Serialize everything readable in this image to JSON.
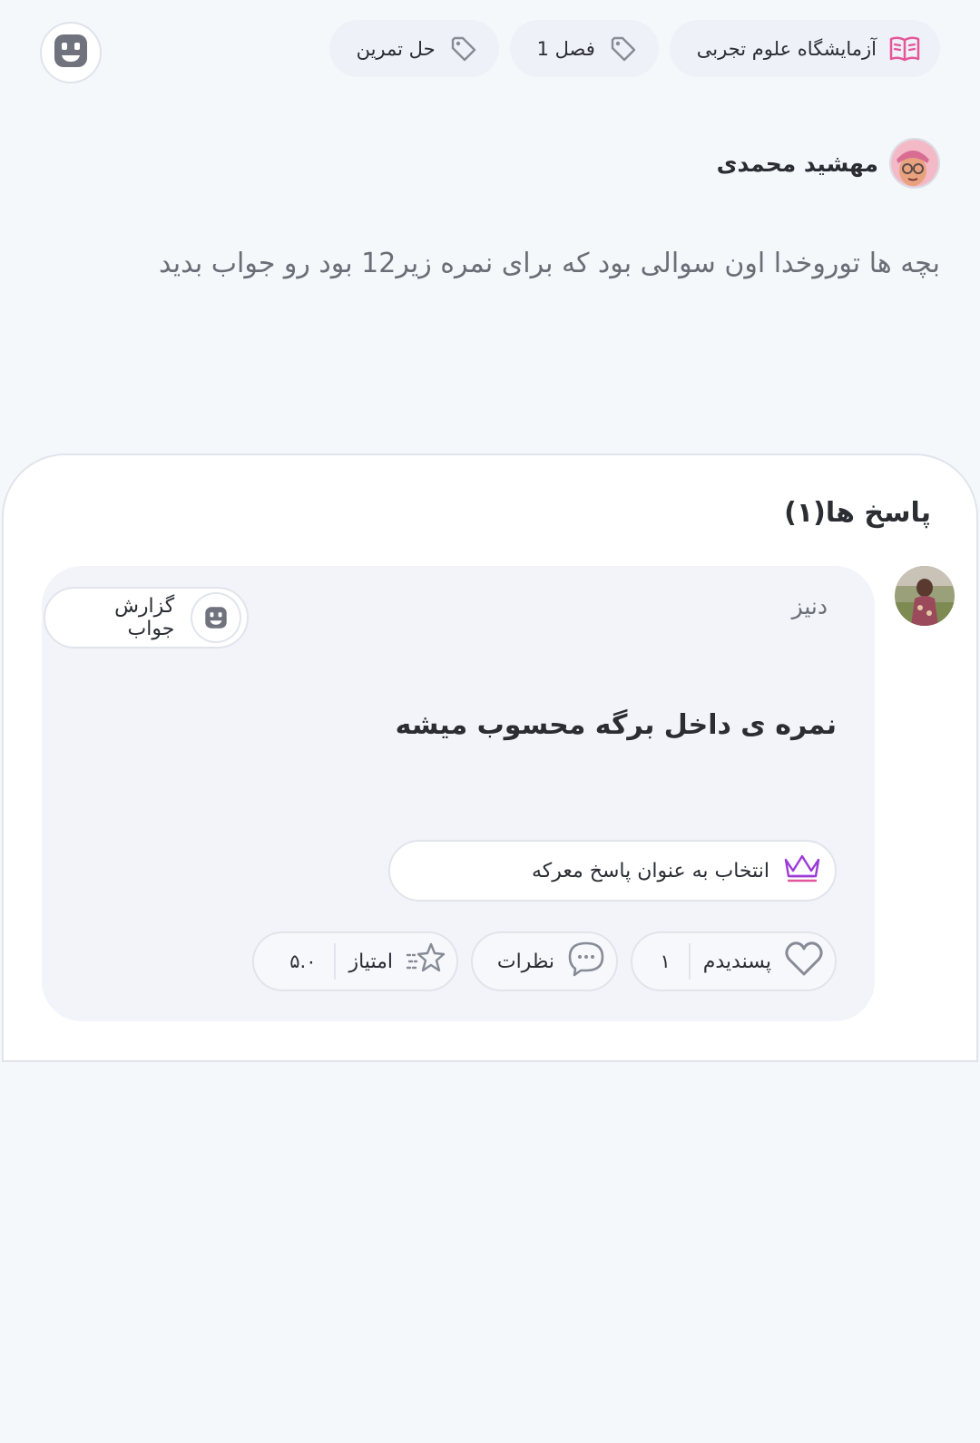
{
  "header": {
    "tags": [
      {
        "label": "آزمایشگاه علوم تجربی",
        "icon": "book-icon"
      },
      {
        "label": "فصل 1",
        "icon": "tag-icon"
      },
      {
        "label": "حل تمرین",
        "icon": "tag-icon"
      }
    ]
  },
  "post": {
    "author": "مهشید محمدی",
    "text": "بچه ها توروخدا اون سوالی بود که برای نمره زیر12 بود رو جواب بدید"
  },
  "answers": {
    "title": "پاسخ ها(۱)",
    "items": [
      {
        "user": "دنیز",
        "report_label": "گزارش جواب",
        "text": "نمره ی داخل برگه محسوب میشه",
        "select_label": "انتخاب به عنوان پاسخ معرکه",
        "like_label": "پسندیدم",
        "like_count": "۱",
        "comments_label": "نظرات",
        "score_label": "امتیاز",
        "score_value": "۵.۰"
      }
    ]
  },
  "colors": {
    "accent": "#9b3bd6",
    "book": "#e5559a",
    "icon_gray": "#868b96"
  }
}
